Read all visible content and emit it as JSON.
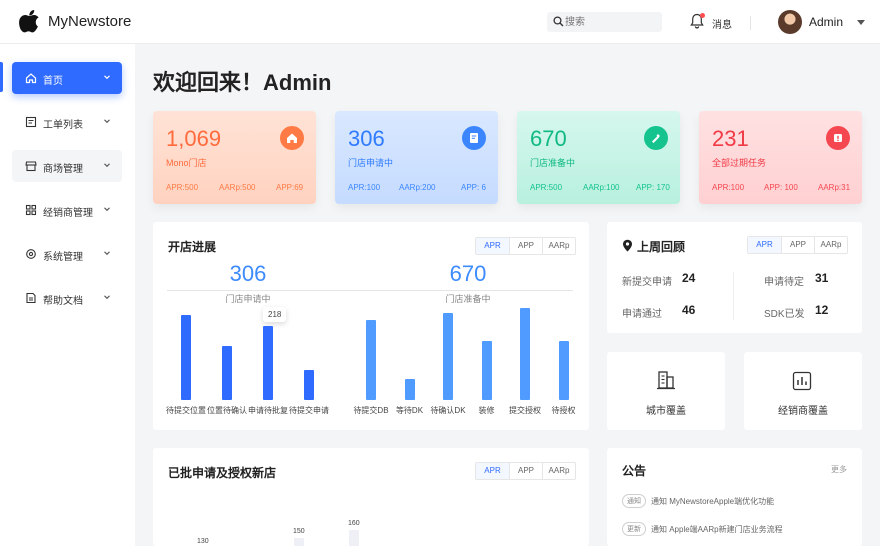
{
  "header": {
    "brand": "MyNewstore",
    "search_placeholder": "搜索",
    "message_label": "消息",
    "user_name": "Admin"
  },
  "sidebar": {
    "items": [
      {
        "label": "首页",
        "icon": "home-icon"
      },
      {
        "label": "工单列表",
        "icon": "ticket-icon"
      },
      {
        "label": "商场管理",
        "icon": "store-icon"
      },
      {
        "label": "经销商管理",
        "icon": "grid-icon"
      },
      {
        "label": "系统管理",
        "icon": "settings-icon"
      },
      {
        "label": "帮助文档",
        "icon": "document-icon"
      }
    ]
  },
  "welcome": "欢迎回来！Admin",
  "cards": [
    {
      "value": "1,069",
      "label": "Mono门店",
      "stats": [
        "APR:500",
        "AARp:500",
        "APP:69"
      ],
      "icon": "home-icon",
      "color": "#ff7a45"
    },
    {
      "value": "306",
      "label": "门店申请中",
      "stats": [
        "APR:100",
        "AARp:200",
        "APP: 6"
      ],
      "icon": "edit-doc-icon",
      "color": "#2f8cff"
    },
    {
      "value": "670",
      "label": "门店准备中",
      "stats": [
        "APR:500",
        "AARp:100",
        "APP: 170"
      ],
      "icon": "tool-icon",
      "color": "#14c38e"
    },
    {
      "value": "231",
      "label": "全部过期任务",
      "stats": [
        "APR:100",
        "APP: 100",
        "AARp:31"
      ],
      "icon": "alert-icon",
      "color": "#f5474f"
    }
  ],
  "progress": {
    "title": "开店进展",
    "tabs": [
      "APR",
      "APP",
      "AARp"
    ],
    "left": {
      "value": "306",
      "label": "门店申请中"
    },
    "right": {
      "value": "670",
      "label": "门店准备中"
    },
    "tooltip": "218"
  },
  "review": {
    "title": "上周回顾",
    "tabs": [
      "APR",
      "APP",
      "AARp"
    ],
    "items": [
      {
        "label": "新提交申请",
        "value": "24"
      },
      {
        "label": "申请待定",
        "value": "31"
      },
      {
        "label": "申请通过",
        "value": "46"
      },
      {
        "label": "SDK已发",
        "value": "12"
      }
    ]
  },
  "coverage": [
    {
      "label": "城市覆盖",
      "icon": "city-icon"
    },
    {
      "label": "经销商覆盖",
      "icon": "chart-box-icon"
    }
  ],
  "approved": {
    "title": "已批申请及授权新店",
    "tabs": [
      "APR",
      "APP",
      "AARp"
    ]
  },
  "notice": {
    "title": "公告",
    "more": "更多",
    "items": [
      {
        "tag": "通知",
        "text": "通知 MyNewstoreApple端优化功能"
      },
      {
        "tag": "更新",
        "text": "通知 Apple端AARp新建门店业务流程"
      }
    ]
  },
  "chart_data": [
    {
      "type": "bar",
      "categories": [
        "待提交位置",
        "位置待确认",
        "申请待批复",
        "待提交申请"
      ],
      "values": [
        250,
        160,
        218,
        90
      ],
      "ylim": [
        0,
        260
      ]
    },
    {
      "type": "bar",
      "categories": [
        "待提交DB",
        "等待DK",
        "待确认DK",
        "装修",
        "提交授权",
        "待授权"
      ],
      "values": [
        225,
        60,
        245,
        168,
        260,
        168
      ],
      "ylim": [
        0,
        260
      ]
    },
    {
      "type": "bar",
      "values_visible": [
        "130",
        "150",
        "160"
      ]
    }
  ]
}
